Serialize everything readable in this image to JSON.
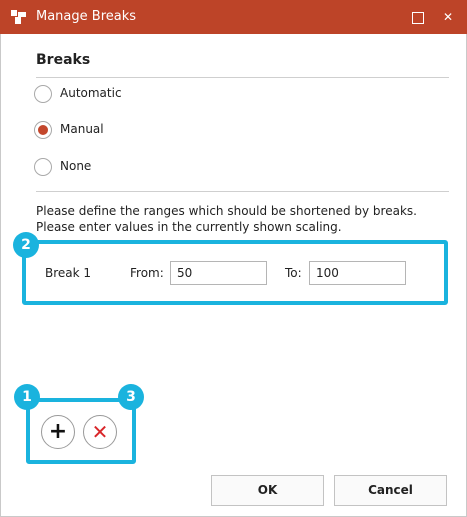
{
  "window": {
    "title": "Manage Breaks",
    "icons": {
      "app": "app-logo-icon",
      "maximize": "maximize-icon",
      "close": "close-icon"
    },
    "close_glyph": "✕",
    "title_bar_color": "#bd4428"
  },
  "breaks_group": {
    "title": "Breaks",
    "options": [
      {
        "label": "Automatic",
        "selected": false
      },
      {
        "label": "Manual",
        "selected": true
      },
      {
        "label": "None",
        "selected": false
      }
    ]
  },
  "description": {
    "line1": "Please define the ranges which should be shortened by breaks.",
    "line2": "Please enter values in the currently shown scaling."
  },
  "break_rows": [
    {
      "name": "Break 1",
      "from_label": "From:",
      "from_value": "50",
      "to_label": "To:",
      "to_value": "100"
    }
  ],
  "row_buttons": {
    "add_glyph": "+",
    "remove_glyph": "✕",
    "icons": {
      "add": "plus-icon",
      "remove": "remove-icon"
    }
  },
  "callouts": {
    "badge1": "1",
    "badge2": "2",
    "badge3": "3",
    "color": "#1ab3de"
  },
  "buttons": {
    "ok": "OK",
    "cancel": "Cancel"
  }
}
